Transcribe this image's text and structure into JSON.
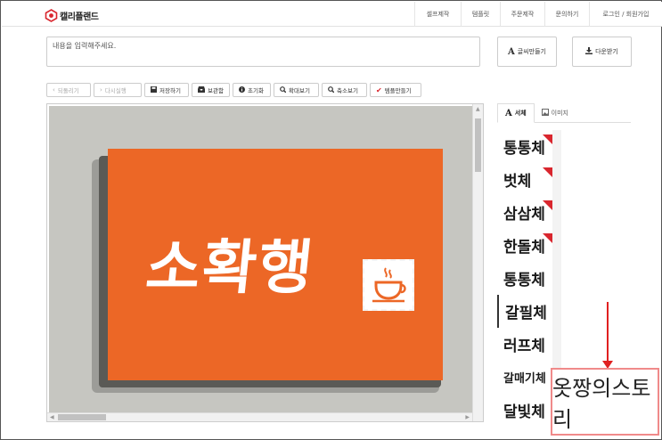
{
  "header": {
    "logo_text": "캘리플랜드",
    "brand_color": "#d9262e",
    "nav": [
      {
        "label": "셀프제작"
      },
      {
        "label": "템플릿"
      },
      {
        "label": "주문제작"
      },
      {
        "label": "문의하기"
      },
      {
        "label": "로그인 / 회원가입"
      }
    ]
  },
  "editor": {
    "text_input_value": "내용을 입력해주세요.",
    "make_font_button": "글씨만들기",
    "make_font_icon": "A",
    "download_button": "다운받기",
    "download_icon": "download-icon"
  },
  "toolbar": {
    "undo": "되돌리기",
    "redo": "다시실행",
    "save": "저장하기",
    "storage": "보관함",
    "reset": "초기화",
    "zoom_in": "확대보기",
    "zoom_out": "축소보기",
    "template": "템플만들기"
  },
  "canvas": {
    "card_text": "소확행",
    "card_color": "#ec6726",
    "background_color": "#c6c6c1",
    "icon": "coffee-cup-icon"
  },
  "side_panel": {
    "tab_font": "서체",
    "tab_image": "이미지",
    "fonts": [
      {
        "name": "통통체",
        "new": true
      },
      {
        "name": "벗체",
        "new": true
      },
      {
        "name": "삼삼체",
        "new": true
      },
      {
        "name": "한돌체",
        "new": true
      },
      {
        "name": "통통체",
        "new": false
      },
      {
        "name": "갈필체",
        "new": false
      },
      {
        "name": "러프체",
        "new": false
      },
      {
        "name": "갈매기체",
        "new": false
      },
      {
        "name": "달빛체",
        "new": false
      }
    ]
  },
  "annotation": {
    "callout_text": "옷짱의스토리",
    "color": "#e02020"
  }
}
